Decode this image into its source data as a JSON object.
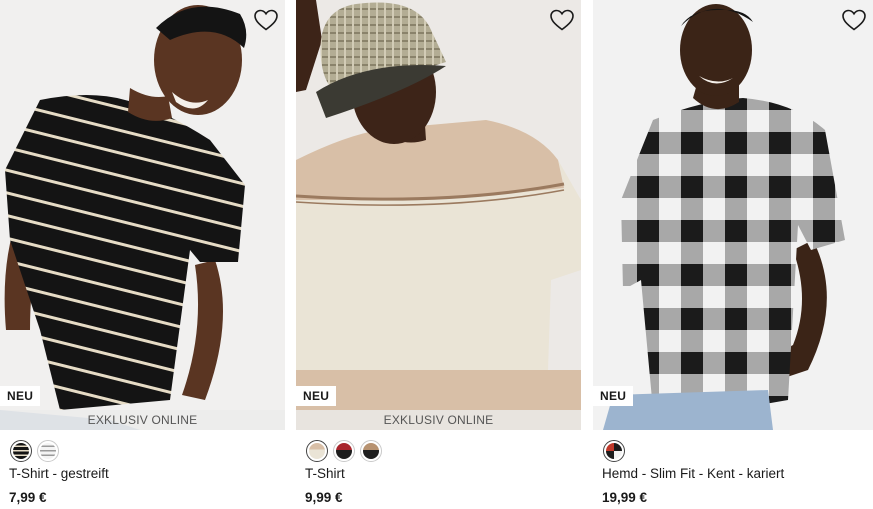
{
  "products": [
    {
      "badge": "NEU",
      "banner": "EXKLUSIV ONLINE",
      "title": "T-Shirt - gestreift",
      "price": "7,99 €",
      "wishlist_icon": "heart-outline-icon",
      "swatches": [
        {
          "color": "black-beige-stripes",
          "selected": true
        },
        {
          "color": "white-grey-stripes",
          "selected": false
        }
      ]
    },
    {
      "badge": "NEU",
      "banner": "EXKLUSIV ONLINE",
      "title": "T-Shirt",
      "price": "9,99 €",
      "wishlist_icon": "heart-outline-icon",
      "swatches": [
        {
          "color": "beige-colorblock",
          "selected": true
        },
        {
          "color": "red-dark-colorblock",
          "selected": false
        },
        {
          "color": "brown-dark-colorblock",
          "selected": false
        }
      ]
    },
    {
      "badge": "NEU",
      "banner": "",
      "title": "Hemd - Slim Fit - Kent - kariert",
      "price": "19,99 €",
      "wishlist_icon": "heart-outline-icon",
      "swatches": [
        {
          "color": "black-white-check",
          "selected": true
        }
      ]
    }
  ],
  "colors": {
    "text": "#1a1a1a",
    "banner_text": "#555555",
    "badge_bg": "#ffffff",
    "stripe_dark": "#141414",
    "stripe_light": "#e6dcc6",
    "tee_sand": "#d8bfa7",
    "tee_cream": "#eae4d6",
    "check_black": "#1b1b1b",
    "check_grey": "#8e8e8e"
  }
}
